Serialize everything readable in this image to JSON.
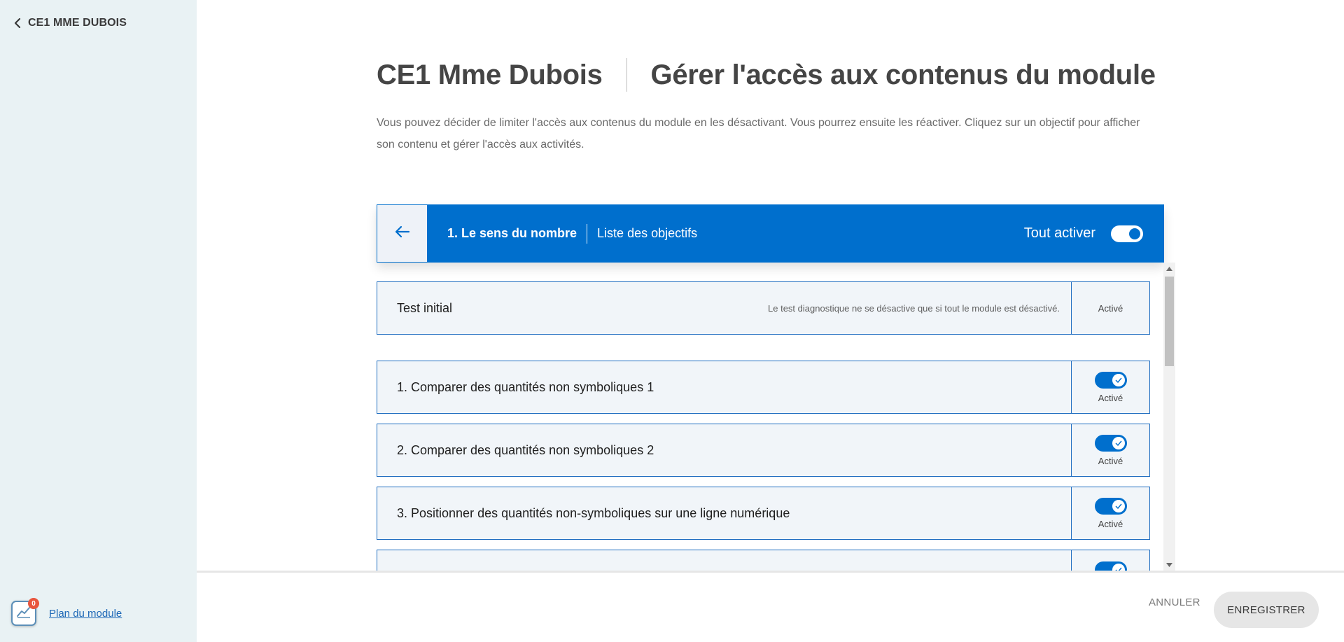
{
  "sidebar": {
    "back_label": "CE1 MME DUBOIS",
    "plan_link": "Plan du module",
    "plan_badge": "0"
  },
  "header": {
    "class_name": "CE1 Mme Dubois",
    "page_title": "Gérer l'accès aux contenus du module",
    "intro": "Vous pouvez décider de limiter l'accès aux contenus du module en les désactivant. Vous pourrez ensuite les réactiver. Cliquez sur un objectif pour afficher son contenu et gérer l'accès aux activités."
  },
  "module_bar": {
    "module_name": "1. Le sens du nombre",
    "subtitle": "Liste des objectifs",
    "toggle_all_label": "Tout activer",
    "toggle_all_on": true
  },
  "test_row": {
    "title": "Test initial",
    "note": "Le test diagnostique ne se désactive que si tout le module est désactivé.",
    "status": "Activé"
  },
  "objectives": [
    {
      "title": "1. Comparer des quantités non symboliques 1",
      "status": "Activé",
      "enabled": true
    },
    {
      "title": "2. Comparer des quantités non symboliques 2",
      "status": "Activé",
      "enabled": true
    },
    {
      "title": "3. Positionner des quantités non-symboliques sur une ligne numérique",
      "status": "Activé",
      "enabled": true
    },
    {
      "title": "",
      "status": "",
      "enabled": true
    }
  ],
  "footer": {
    "cancel_label": "ANNULER",
    "save_label": "ENREGISTRER"
  },
  "colors": {
    "primary": "#006fcd",
    "sidebar_bg": "#e9f2f4",
    "row_bg": "#f1f5f9",
    "badge": "#e8553d"
  }
}
